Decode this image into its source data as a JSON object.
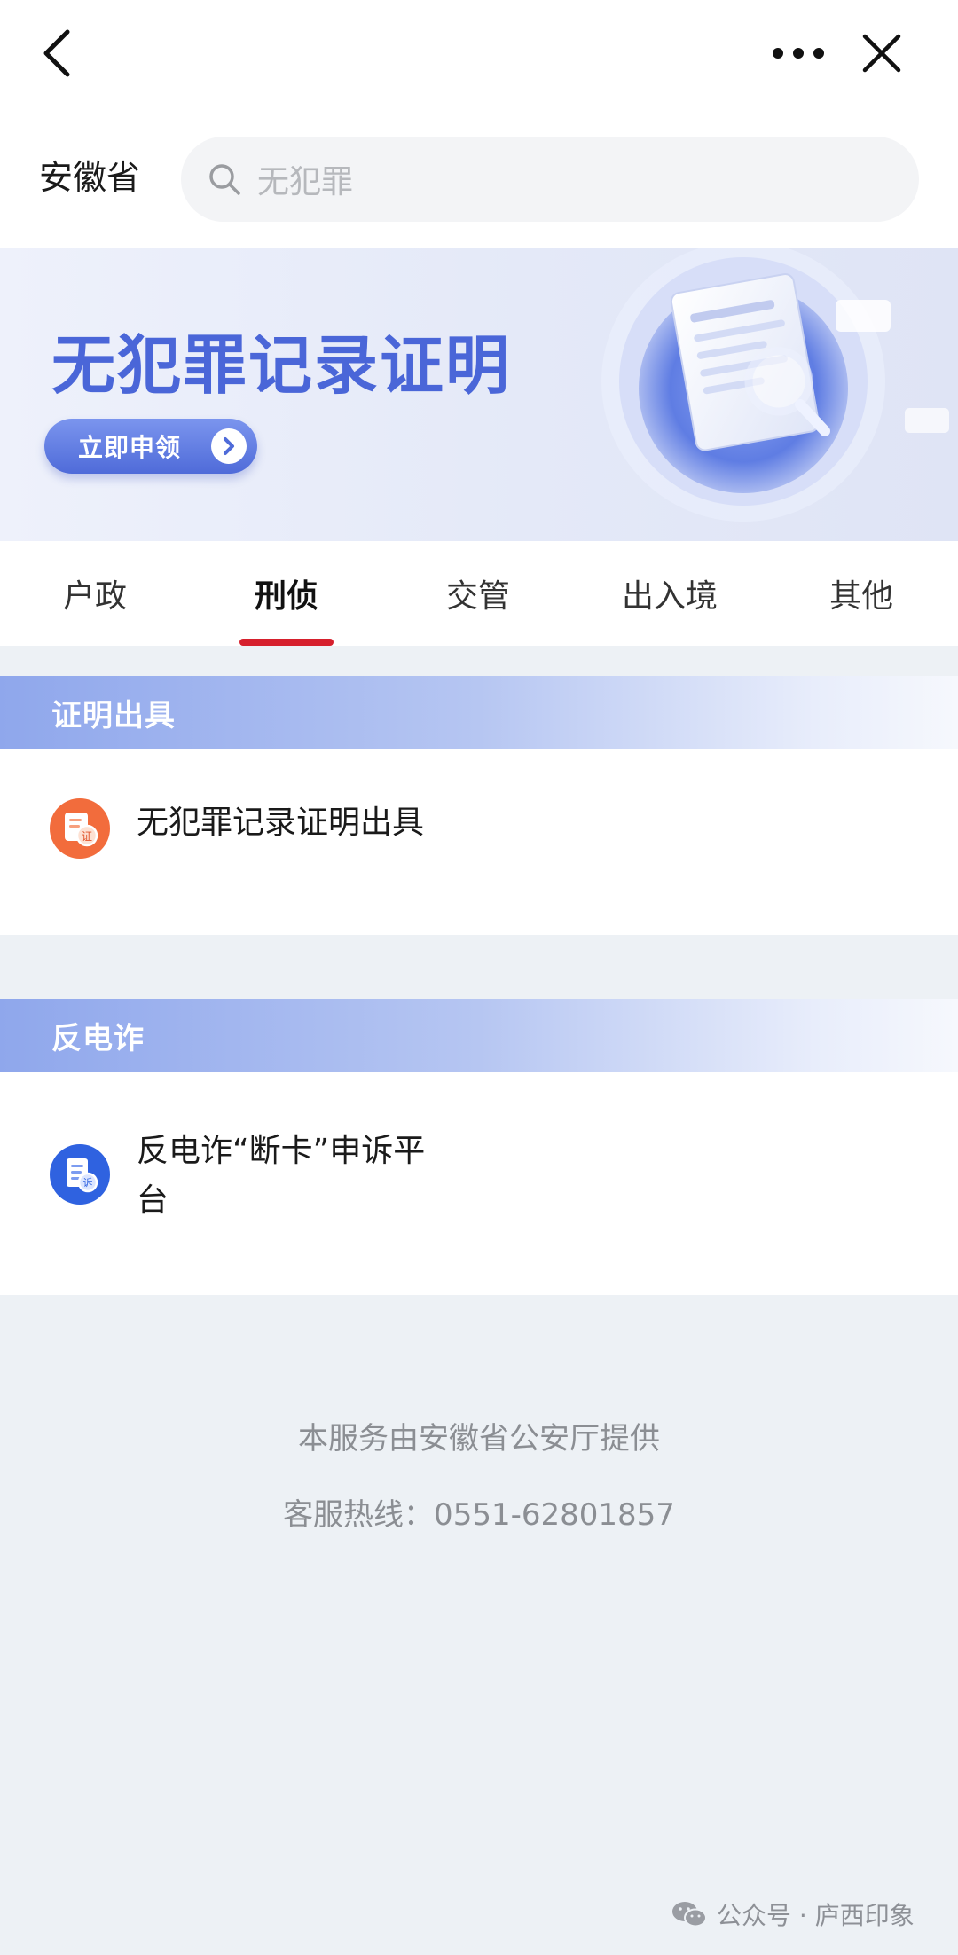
{
  "nav": {
    "back_icon": "chevron-left-icon",
    "more_icon": "more-horizontal-icon",
    "close_icon": "close-icon"
  },
  "header": {
    "province": "安徽省",
    "search_placeholder": "无犯罪"
  },
  "banner": {
    "title": "无犯罪记录证明",
    "button_label": "立即申领",
    "arrow_icon": "chevron-right-circle-icon"
  },
  "tabs": [
    {
      "label": "户政",
      "active": false
    },
    {
      "label": "刑侦",
      "active": true
    },
    {
      "label": "交管",
      "active": false
    },
    {
      "label": "出入境",
      "active": false
    },
    {
      "label": "其他",
      "active": false
    }
  ],
  "sections": [
    {
      "title": "证明出具",
      "items": [
        {
          "label": "无犯罪记录证明出具",
          "icon": "certificate-icon",
          "color": "#f26c3c"
        }
      ]
    },
    {
      "title": "反电诈",
      "items": [
        {
          "label": "反电诈“断卡”申诉平台",
          "icon": "appeal-document-icon",
          "color": "#2f62e0"
        }
      ]
    }
  ],
  "footer": {
    "provider": "本服务由安徽省公安厅提供",
    "hotline": "客服热线：0551-62801857"
  },
  "watermark": {
    "text": "公众号 · 庐西印象",
    "icon": "wechat-icon"
  },
  "colors": {
    "accent_red": "#d6202d",
    "banner_blue": "#4a66d8"
  }
}
